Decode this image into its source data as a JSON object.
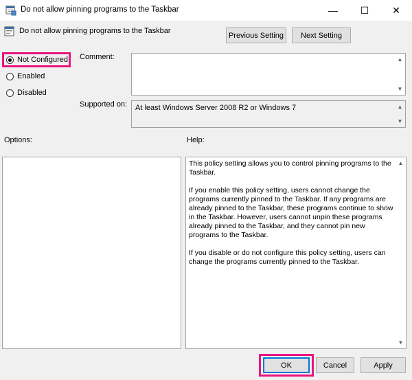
{
  "window": {
    "title": "Do not allow pinning programs to the Taskbar",
    "minimize_glyph": "—",
    "maximize_glyph": "☐",
    "close_glyph": "✕"
  },
  "header": {
    "setting_name": "Do not allow pinning programs to the Taskbar",
    "previous_label": "Previous Setting",
    "next_label": "Next Setting"
  },
  "state": {
    "options": [
      {
        "label": "Not Configured",
        "selected": true
      },
      {
        "label": "Enabled",
        "selected": false
      },
      {
        "label": "Disabled",
        "selected": false
      }
    ]
  },
  "comment": {
    "label": "Comment:",
    "value": ""
  },
  "supported": {
    "label": "Supported on:",
    "value": "At least Windows Server 2008 R2 or Windows 7"
  },
  "options_panel": {
    "label": "Options:"
  },
  "help_panel": {
    "label": "Help:",
    "paragraphs": [
      "This policy setting allows you to control pinning programs to the Taskbar.",
      "If you enable this policy setting, users cannot change the programs currently pinned to the Taskbar. If any programs are already pinned to the Taskbar, these programs continue to show in the Taskbar. However, users cannot unpin these programs already pinned to the Taskbar, and they cannot pin new programs to the Taskbar.",
      "If you disable or do not configure this policy setting, users can change the programs currently pinned to the Taskbar."
    ]
  },
  "footer": {
    "ok_label": "OK",
    "cancel_label": "Cancel",
    "apply_label": "Apply"
  },
  "colors": {
    "highlight": "#e8157f",
    "accent": "#0078d7"
  },
  "icons": {
    "window": "policy-icon",
    "setting": "policy-icon",
    "scroll_up": "chevron-up-icon",
    "scroll_down": "chevron-down-icon"
  }
}
